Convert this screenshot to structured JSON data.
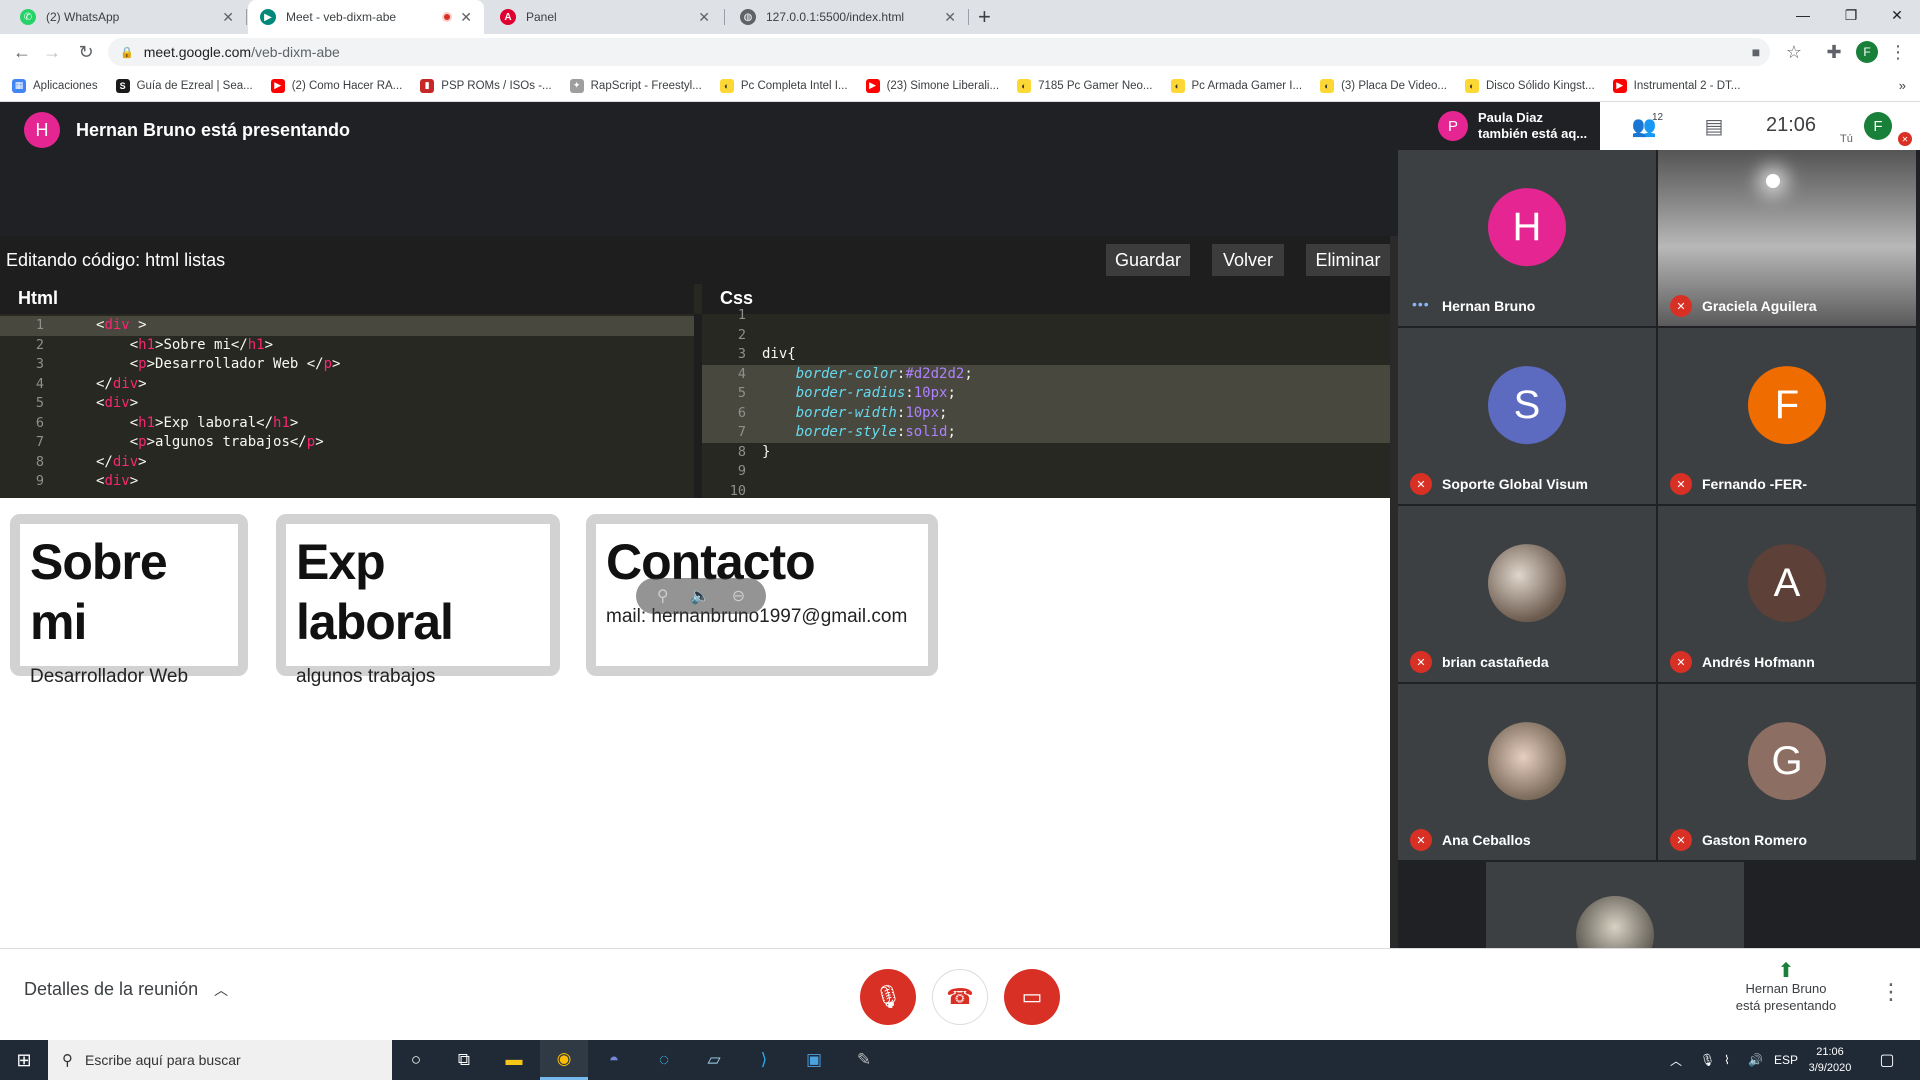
{
  "browser": {
    "tabs": [
      {
        "title": "(2) WhatsApp",
        "favicon": "whatsapp-icon",
        "favicon_color": "#25d366"
      },
      {
        "title": "Meet - veb-dixm-abe",
        "favicon": "meet-icon",
        "favicon_color": "#00897b",
        "recording": true
      },
      {
        "title": "Panel",
        "favicon": "angular-icon",
        "favicon_color": "#dd0031"
      },
      {
        "title": "127.0.0.1:5500/index.html",
        "favicon": "globe-icon",
        "favicon_color": "#5f6368"
      }
    ],
    "url_host": "meet.google.com",
    "url_path": "/veb-dixm-abe",
    "profile_initial": "F",
    "bookmarks": [
      {
        "label": "Aplicaciones",
        "icon": "apps-grid-icon",
        "color": "#4285f4"
      },
      {
        "label": "Guía de Ezreal | Sea...",
        "icon": "s-icon",
        "color": "#1a1a1a"
      },
      {
        "label": "(2) Como Hacer RA...",
        "icon": "youtube-icon",
        "color": "#ff0000"
      },
      {
        "label": "PSP ROMs / ISOs -...",
        "icon": "rom-icon",
        "color": "#c62828"
      },
      {
        "label": "RapScript - Freestyl...",
        "icon": "puzzle-icon",
        "color": "#9e9e9e"
      },
      {
        "label": "Pc Completa Intel I...",
        "icon": "mercadolibre-icon",
        "color": "#fdd835"
      },
      {
        "label": "(23) Simone Liberali...",
        "icon": "youtube-icon",
        "color": "#ff0000"
      },
      {
        "label": "7185 Pc Gamer Neo...",
        "icon": "mercadolibre-icon",
        "color": "#fdd835"
      },
      {
        "label": "Pc Armada Gamer I...",
        "icon": "mercadolibre-icon",
        "color": "#fdd835"
      },
      {
        "label": "(3) Placa De Video...",
        "icon": "mercadolibre-icon",
        "color": "#fdd835"
      },
      {
        "label": "Disco Sólido Kingst...",
        "icon": "mercadolibre-icon",
        "color": "#fdd835"
      },
      {
        "label": "Instrumental 2 - DT...",
        "icon": "youtube-icon",
        "color": "#ff0000"
      }
    ]
  },
  "meet": {
    "presenter_initial": "H",
    "presenter_banner": "Hernan Bruno está presentando",
    "also_presenting_initial": "P",
    "also_presenting_line1": "Paula Diaz",
    "also_presenting_line2": "también está aq...",
    "participant_count": "12",
    "time": "21:06",
    "me_initial": "F",
    "me_label": "Tú",
    "details_label": "Detalles de la reunión",
    "presenting_line1": "Hernan Bruno",
    "presenting_line2": "está presentando"
  },
  "editor": {
    "title": "Editando código: html listas",
    "buttons": {
      "save": "Guardar",
      "back": "Volver",
      "delete": "Eliminar"
    },
    "html_pane_title": "Html",
    "css_pane_title": "Css",
    "html_lines": [
      {
        "n": "1",
        "text": "<div >"
      },
      {
        "n": "2",
        "text": "    <h1>Sobre mi</h1>"
      },
      {
        "n": "3",
        "text": "    <p>Desarrollador Web </p>"
      },
      {
        "n": "4",
        "text": "</div>"
      },
      {
        "n": "5",
        "text": "<div>"
      },
      {
        "n": "6",
        "text": "    <h1>Exp laboral</h1>"
      },
      {
        "n": "7",
        "text": "    <p>algunos trabajos</p>"
      },
      {
        "n": "8",
        "text": "</div>"
      },
      {
        "n": "9",
        "text": "<div>"
      }
    ],
    "css_lines": [
      {
        "n": "1",
        "text": ""
      },
      {
        "n": "2",
        "text": ""
      },
      {
        "n": "3",
        "text": "div{"
      },
      {
        "n": "4",
        "prop": "border-color",
        "val": "#d2d2d2"
      },
      {
        "n": "5",
        "prop": "border-radius",
        "val": "10px"
      },
      {
        "n": "6",
        "prop": "border-width",
        "val": "10px"
      },
      {
        "n": "7",
        "prop": "border-style",
        "val": "solid"
      },
      {
        "n": "8",
        "text": "}"
      },
      {
        "n": "9",
        "text": ""
      },
      {
        "n": "10",
        "text": ""
      }
    ]
  },
  "preview": {
    "cards": [
      {
        "heading": "Sobre mi",
        "text": "Desarrollador Web"
      },
      {
        "heading": "Exp laboral",
        "text": "algunos trabajos"
      },
      {
        "heading": "Contacto",
        "text": "mail: hernanbruno1997@gmail.com"
      }
    ]
  },
  "participants": [
    {
      "name": "Hernan Bruno",
      "initial": "H",
      "color": "#e52592",
      "state": "speaking"
    },
    {
      "name": "Graciela Aguilera",
      "state": "muted",
      "video": true
    },
    {
      "name": "Soporte Global Visum",
      "initial": "S",
      "color": "#5c6bc0",
      "state": "muted"
    },
    {
      "name": "Fernando -FER-",
      "initial": "F",
      "color": "#ef6c00",
      "state": "muted"
    },
    {
      "name": "brian castañeda",
      "state": "muted",
      "photo": true
    },
    {
      "name": "Andrés Hofmann",
      "initial": "A",
      "color": "#5d4037",
      "state": "muted"
    },
    {
      "name": "Ana Ceballos",
      "state": "muted",
      "photo": true
    },
    {
      "name": "Gaston Romero",
      "initial": "G",
      "color": "#8d6e63",
      "state": "muted"
    }
  ],
  "taskbar": {
    "search_placeholder": "Escribe aquí para buscar",
    "language": "ESP",
    "time": "21:06",
    "date": "3/9/2020"
  }
}
